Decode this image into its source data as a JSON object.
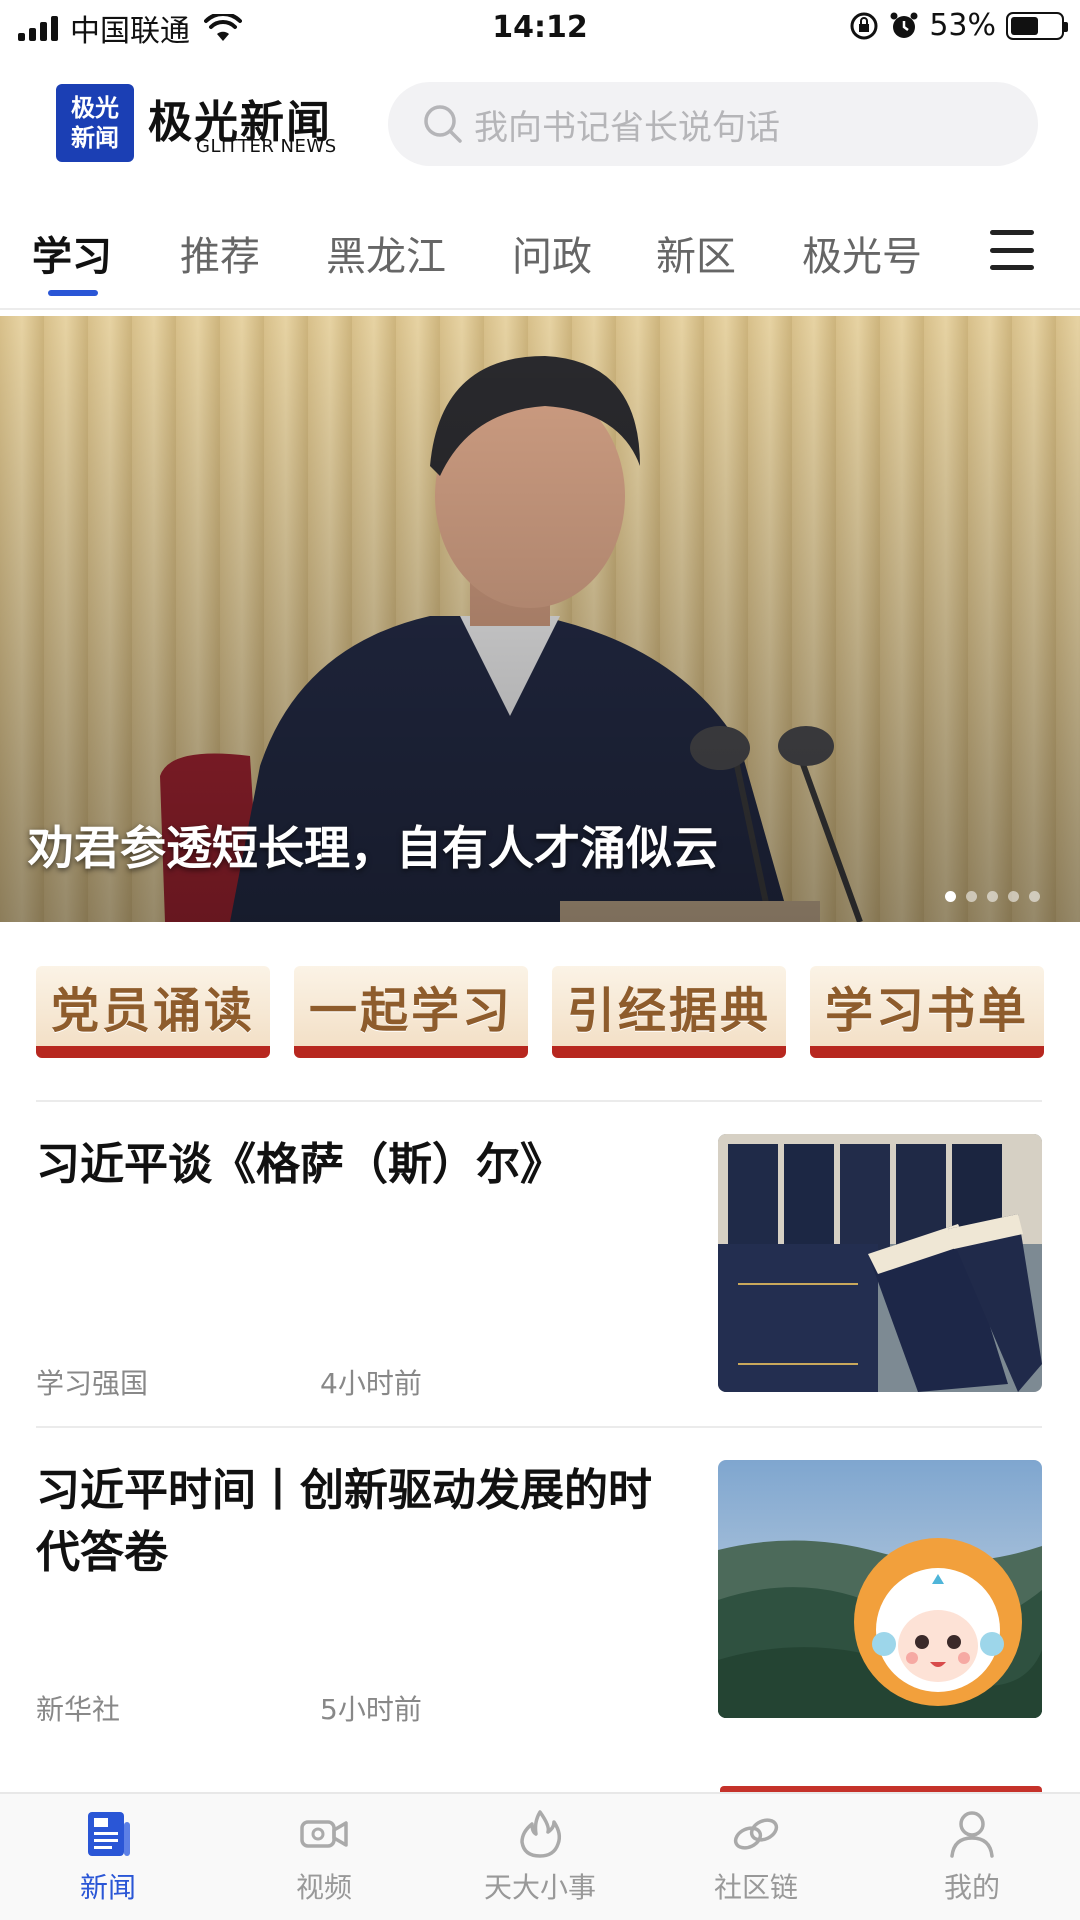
{
  "status_bar": {
    "carrier": "中国联通",
    "time": "14:12",
    "battery": "53%",
    "battery_level": 0.53
  },
  "header": {
    "logo_mark_top": "极光",
    "logo_mark_bottom": "新闻",
    "logo_title": "极光新闻",
    "logo_subtitle": "GLITTER NEWS",
    "search_placeholder": "我向书记省长说句话"
  },
  "tabs": [
    {
      "label": "学习",
      "active": true
    },
    {
      "label": "推荐"
    },
    {
      "label": "黑龙江"
    },
    {
      "label": "问政"
    },
    {
      "label": "新区"
    },
    {
      "label": "极光号"
    }
  ],
  "hero": {
    "caption": "劝君参透短长理，自有人才涌似云",
    "slides": 5,
    "current_slide": 1
  },
  "quick_links": [
    "党员诵读",
    "一起学习",
    "引经据典",
    "学习书单"
  ],
  "news": [
    {
      "title": "习近平谈《格萨（斯）尔》",
      "source": "学习强国",
      "time": "4小时前"
    },
    {
      "title": "习近平时间丨创新驱动发展的时代答卷",
      "source": "新华社",
      "time": "5小时前"
    }
  ],
  "bottom_nav": [
    {
      "label": "新闻",
      "icon": "newspaper-icon",
      "active": true
    },
    {
      "label": "视频",
      "icon": "video-camera-icon"
    },
    {
      "label": "天大小事",
      "icon": "flame-icon"
    },
    {
      "label": "社区链",
      "icon": "link-icon"
    },
    {
      "label": "我的",
      "icon": "person-icon"
    }
  ],
  "colors": {
    "accent": "#2a56d6",
    "logo_blue": "#1b3fb4",
    "quick_base_red": "#b7271f",
    "quick_text": "#8e5c2c"
  }
}
